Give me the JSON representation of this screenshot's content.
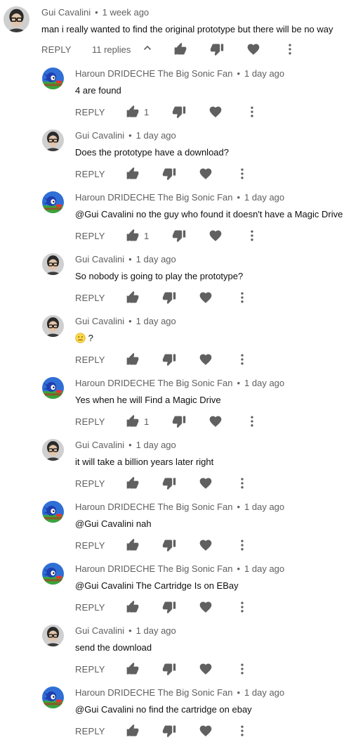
{
  "top_comment": {
    "author": "Gui Cavalini",
    "time": "1 week ago",
    "text": "man i really wanted to find the original prototype but there will be no way",
    "reply_label": "REPLY",
    "replies_count": "11 replies",
    "avatar": "gui-avatar"
  },
  "replies": [
    {
      "author": "Haroun DRIDECHE The Big Sonic Fan",
      "time": "1 day ago",
      "text": "4 are found",
      "likes": "1",
      "avatar": "sonic-avatar"
    },
    {
      "author": "Gui Cavalini",
      "time": "1 day ago",
      "text": "Does the prototype have a download?",
      "likes": "",
      "avatar": "gui-avatar"
    },
    {
      "author": "Haroun DRIDECHE The Big Sonic Fan",
      "time": "1 day ago",
      "text": "@Gui Cavalini no the guy who found it doesn't have a Magic Drive",
      "likes": "1",
      "avatar": "sonic-avatar"
    },
    {
      "author": "Gui Cavalini",
      "time": "1 day ago",
      "text": "So nobody is going to play the prototype?",
      "likes": "",
      "avatar": "gui-avatar"
    },
    {
      "author": "Gui Cavalini",
      "time": "1 day ago",
      "text": "?",
      "likes": "",
      "avatar": "gui-avatar",
      "emoji": "neutral-face"
    },
    {
      "author": "Haroun DRIDECHE The Big Sonic Fan",
      "time": "1 day ago",
      "text": "Yes when he will Find a Magic Drive",
      "likes": "1",
      "avatar": "sonic-avatar"
    },
    {
      "author": "Gui Cavalini",
      "time": "1 day ago",
      "text": "it will take a billion years later right",
      "likes": "",
      "avatar": "gui-avatar"
    },
    {
      "author": "Haroun DRIDECHE The Big Sonic Fan",
      "time": "1 day ago",
      "text": "@Gui Cavalini nah",
      "likes": "",
      "avatar": "sonic-avatar"
    },
    {
      "author": "Haroun DRIDECHE The Big Sonic Fan",
      "time": "1 day ago",
      "text": "@Gui Cavalini The Cartridge Is on EBay",
      "likes": "",
      "avatar": "sonic-avatar"
    },
    {
      "author": "Gui Cavalini",
      "time": "1 day ago",
      "text": "send the download",
      "likes": "",
      "avatar": "gui-avatar"
    },
    {
      "author": "Haroun DRIDECHE The Big Sonic Fan",
      "time": "1 day ago",
      "text": "@Gui Cavalini no find the cartridge on ebay",
      "likes": "",
      "avatar": "sonic-avatar"
    }
  ],
  "labels": {
    "reply": "REPLY",
    "dot": "•"
  },
  "icons": {
    "like": "thumb-up-icon",
    "dislike": "thumb-down-icon",
    "heart": "heart-icon",
    "more": "more-vert-icon",
    "collapse": "chevron-up-icon"
  },
  "colors": {
    "meta": "#606060",
    "text": "#0f0f0f",
    "icon": "#606060"
  }
}
